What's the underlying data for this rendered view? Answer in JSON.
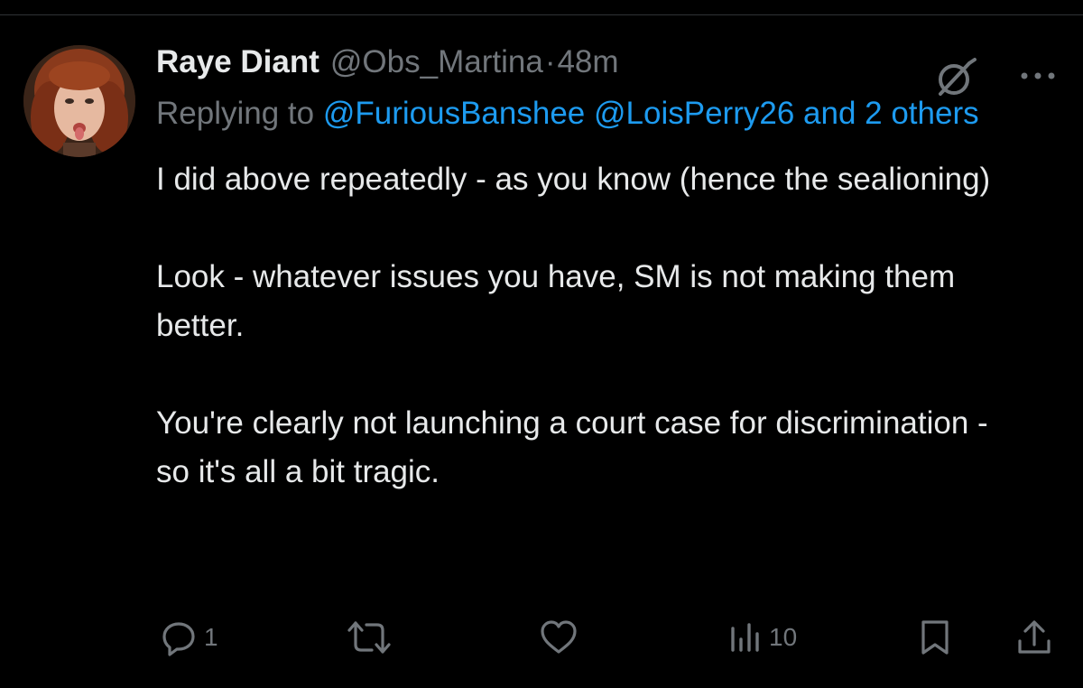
{
  "tweet": {
    "author": {
      "display_name": "Raye Diant",
      "handle": "@Obs_Martina",
      "separator": "·",
      "time": "48m"
    },
    "reply": {
      "prefix": "Replying to",
      "mention_1": "@FuriousBanshee",
      "mention_2": "@LoisPerry26",
      "others": "and 2 others"
    },
    "paragraphs": [
      "I did above repeatedly - as you know (hence the sealioning)",
      "Look - whatever issues you have, SM is not making them better.",
      "You're clearly not launching a court case for discrimination - so it's all a bit tragic."
    ],
    "actions": {
      "reply_count": "1",
      "retweet_count": "",
      "like_count": "",
      "views_count": "10"
    }
  },
  "icons": {
    "reply": "reply-icon",
    "retweet": "retweet-icon",
    "like": "heart-icon",
    "views": "views-chart-icon",
    "bookmark": "bookmark-icon",
    "share": "share-icon",
    "grok": "grok-icon",
    "more": "more-icon"
  },
  "colors": {
    "background": "#000000",
    "text": "#e7e9ea",
    "muted": "#71767b",
    "link": "#1d9bf0",
    "divider": "#2f3336"
  }
}
